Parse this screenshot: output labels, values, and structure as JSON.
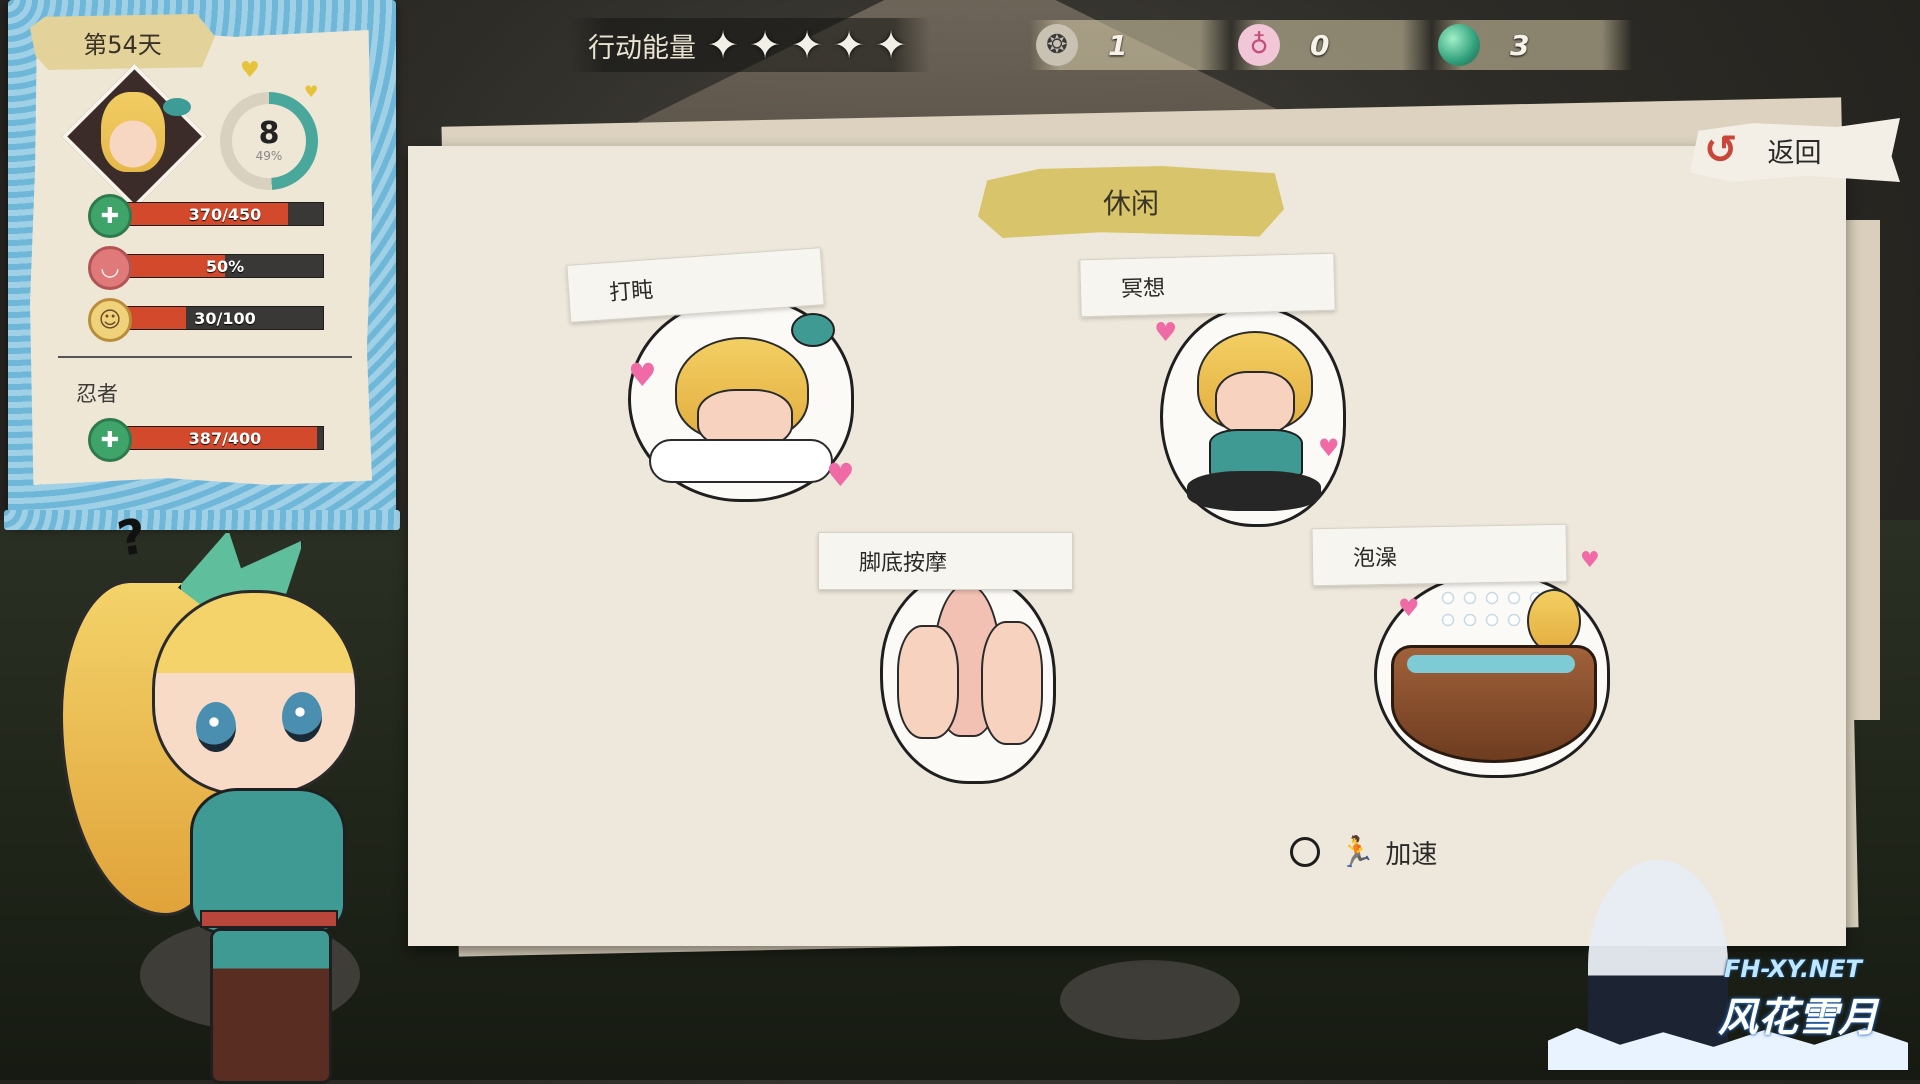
{
  "status": {
    "day": "第54天",
    "level": "8",
    "level_percent": "49%",
    "level_progress": 0.49,
    "hp": {
      "text": "370/450",
      "ratio": 0.822
    },
    "lust": {
      "text": "50%",
      "ratio": 0.5
    },
    "mood": {
      "text": "30/100",
      "ratio": 0.3
    },
    "class_name": "忍者",
    "class_hp": {
      "text": "387/400",
      "ratio": 0.9675
    }
  },
  "hud": {
    "energy_label": "行动能量",
    "energy_stars": [
      "✦",
      "✦",
      "✦",
      "✦",
      "✦"
    ],
    "resources": [
      {
        "icon": "money-bag-icon",
        "glyph": "👝",
        "value": "1"
      },
      {
        "icon": "potion-icon",
        "glyph": "🧪",
        "value": "0"
      },
      {
        "icon": "gem-icon",
        "glyph": "●",
        "value": "3"
      }
    ]
  },
  "return_button": {
    "label": "返回"
  },
  "panel": {
    "title": "休闲",
    "activities": [
      {
        "label": "打盹"
      },
      {
        "label": "冥想"
      },
      {
        "label": "脚底按摩"
      },
      {
        "label": "泡澡"
      }
    ],
    "speed_label": "加速"
  },
  "watermark": {
    "site": "FH-XY.NET",
    "name": "风花雪月"
  },
  "colors": {
    "bar_fill": "#d24a2b",
    "title_banner": "#d8c56b",
    "panel_bg": "#eee8dc",
    "frame_blue": "#6fb7d8"
  }
}
